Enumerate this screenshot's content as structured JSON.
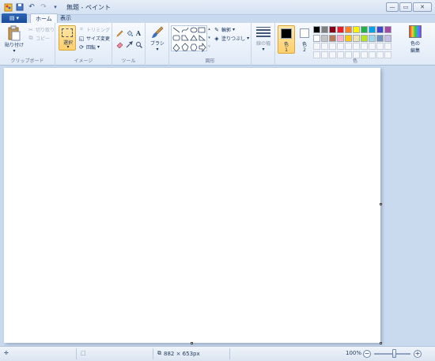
{
  "window": {
    "title": "無題 - ペイント",
    "minimize": "—",
    "maximize": "▭",
    "close": "✕"
  },
  "qat": [
    "save-icon",
    "undo-icon",
    "redo-icon",
    "customize-icon"
  ],
  "tabs": {
    "home": "ホーム",
    "view": "表示"
  },
  "groups": {
    "clipboard": {
      "label": "クリップボード",
      "paste": "貼り付け",
      "cut": "切り取り",
      "copy": "コピー"
    },
    "image": {
      "label": "イメージ",
      "select": "選択",
      "crop": "トリミング",
      "resize": "サイズ変更",
      "rotate": "回転"
    },
    "tools": {
      "label": "ツール"
    },
    "brushes": {
      "label": "ブラシ"
    },
    "shapes": {
      "label": "図形",
      "outline": "輪郭",
      "fill": "塗りつぶし"
    },
    "size": {
      "label": "線の幅"
    },
    "colors": {
      "label": "色",
      "color1": "色",
      "color1_num": "1",
      "color2": "色",
      "color2_num": "2",
      "edit_line1": "色の",
      "edit_line2": "編集",
      "color1_value": "#000000",
      "color2_value": "#ffffff",
      "palette_row1": [
        "#000000",
        "#7f7f7f",
        "#880015",
        "#ed1c24",
        "#ff7f27",
        "#fff200",
        "#22b14c",
        "#00a2e8",
        "#3f48cc",
        "#a349a4"
      ],
      "palette_row2": [
        "#ffffff",
        "#c3c3c3",
        "#b97a57",
        "#ffaec9",
        "#ffc90e",
        "#efe4b0",
        "#b5e61d",
        "#99d9ea",
        "#7092be",
        "#c8bfe7"
      ]
    }
  },
  "status": {
    "canvas_size": "882 × 653px",
    "zoom": "100%"
  }
}
